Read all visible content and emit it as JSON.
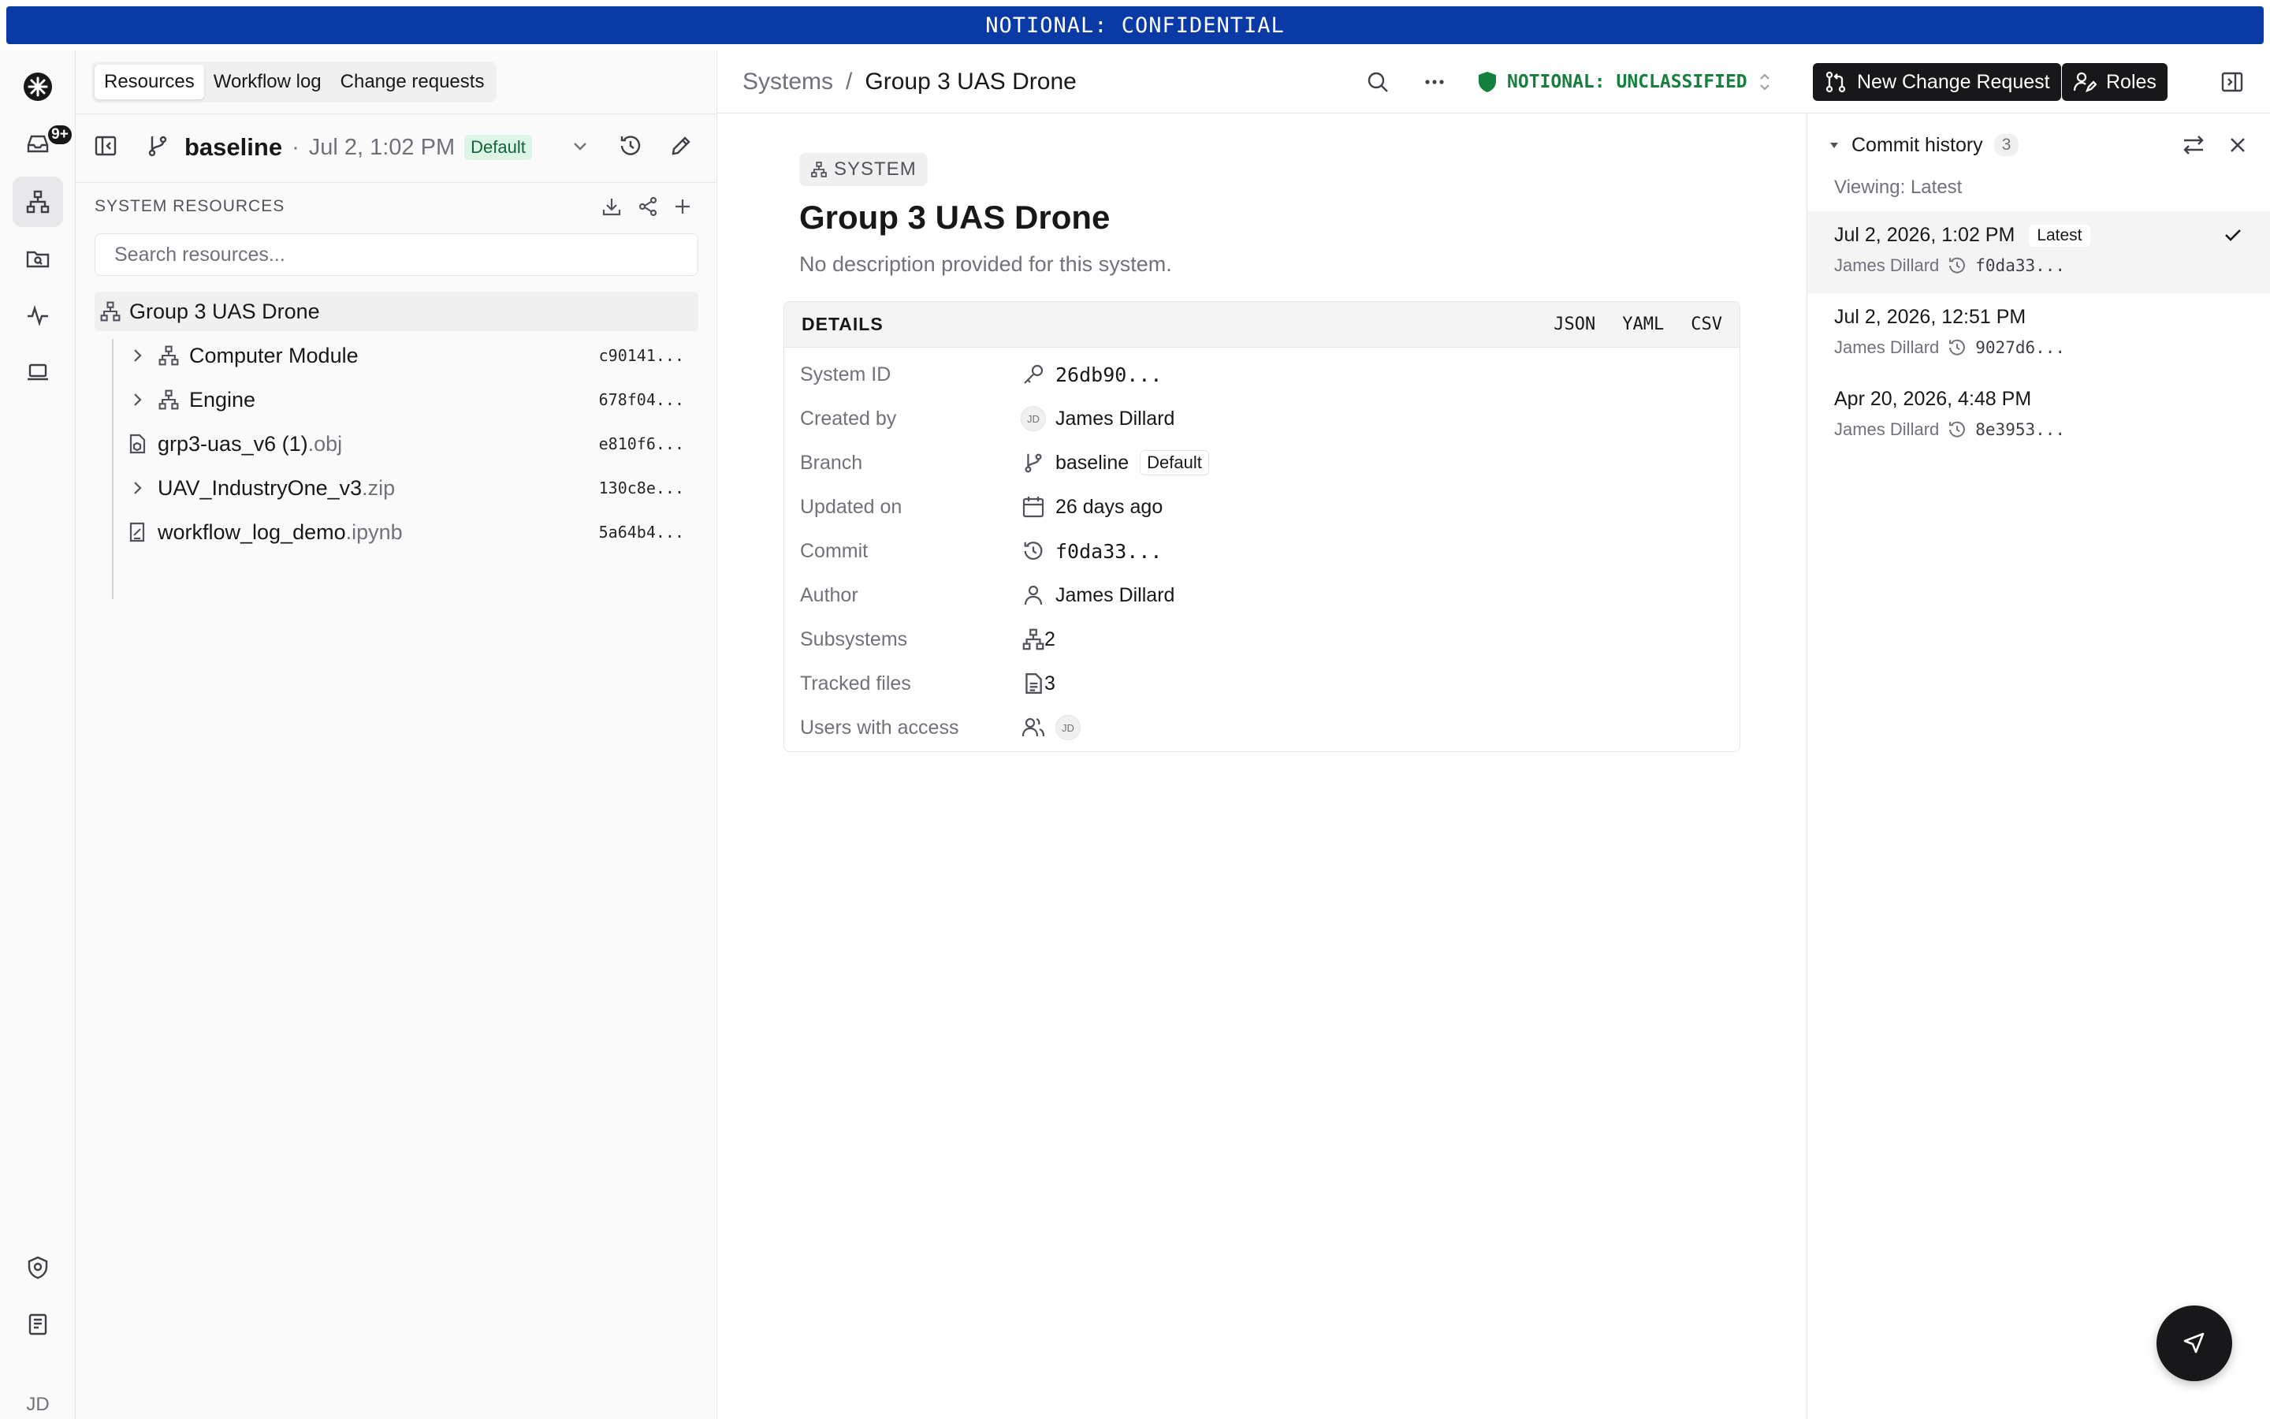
{
  "banner": {
    "text": "NOTIONAL: CONFIDENTIAL"
  },
  "rail": {
    "notification_badge": "9+",
    "avatar": "JD"
  },
  "left": {
    "tabs": [
      {
        "label": "Resources"
      },
      {
        "label": "Workflow log"
      },
      {
        "label": "Change requests"
      }
    ],
    "branch": {
      "name": "baseline",
      "date": "Jul 2, 1:02 PM",
      "badge": "Default"
    },
    "section_title": "SYSTEM RESOURCES",
    "search_placeholder": "Search resources...",
    "tree": [
      {
        "name": "Group 3 UAS Drone",
        "ext": "",
        "hash": ""
      },
      {
        "name": "Computer Module",
        "ext": "",
        "hash": "c90141..."
      },
      {
        "name": "Engine",
        "ext": "",
        "hash": "678f04..."
      },
      {
        "name": "grp3-uas_v6 (1)",
        "ext": ".obj",
        "hash": "e810f6..."
      },
      {
        "name": "UAV_IndustryOne_v3",
        "ext": ".zip",
        "hash": "130c8e..."
      },
      {
        "name": "workflow_log_demo",
        "ext": ".ipynb",
        "hash": "5a64b4..."
      }
    ]
  },
  "topbar": {
    "breadcrumb_root": "Systems",
    "breadcrumb_sep": "/",
    "breadcrumb_current": "Group 3 UAS Drone",
    "classification": "NOTIONAL: UNCLASSIFIED",
    "classification_color": "#15803d",
    "new_cr_label": "New Change Request",
    "roles_label": "Roles"
  },
  "main": {
    "type_label": "SYSTEM",
    "title": "Group 3 UAS Drone",
    "description": "No description provided for this system.",
    "details_title": "DETAILS",
    "formats": [
      "JSON",
      "YAML",
      "CSV"
    ],
    "details": {
      "system_id": {
        "label": "System ID",
        "value": "26db90..."
      },
      "created_by": {
        "label": "Created by",
        "initials": "JD",
        "value": "James Dillard"
      },
      "branch": {
        "label": "Branch",
        "value": "baseline",
        "badge": "Default"
      },
      "updated_on": {
        "label": "Updated on",
        "value": "26 days ago"
      },
      "commit": {
        "label": "Commit",
        "value": "f0da33..."
      },
      "author": {
        "label": "Author",
        "value": "James Dillard"
      },
      "subsystems": {
        "label": "Subsystems",
        "value": "2"
      },
      "tracked_files": {
        "label": "Tracked files",
        "value": "3"
      },
      "users_access": {
        "label": "Users with access",
        "initials": "JD"
      }
    }
  },
  "commit_history": {
    "title": "Commit history",
    "count": "3",
    "viewing": "Viewing: Latest",
    "commits": [
      {
        "date": "Jul 2, 2026, 1:02 PM",
        "tag": "Latest",
        "author": "James Dillard",
        "hash": "f0da33..."
      },
      {
        "date": "Jul 2, 2026, 12:51 PM",
        "tag": "",
        "author": "James Dillard",
        "hash": "9027d6..."
      },
      {
        "date": "Apr 20, 2026, 4:48 PM",
        "tag": "",
        "author": "James Dillard",
        "hash": "8e3953..."
      }
    ]
  }
}
